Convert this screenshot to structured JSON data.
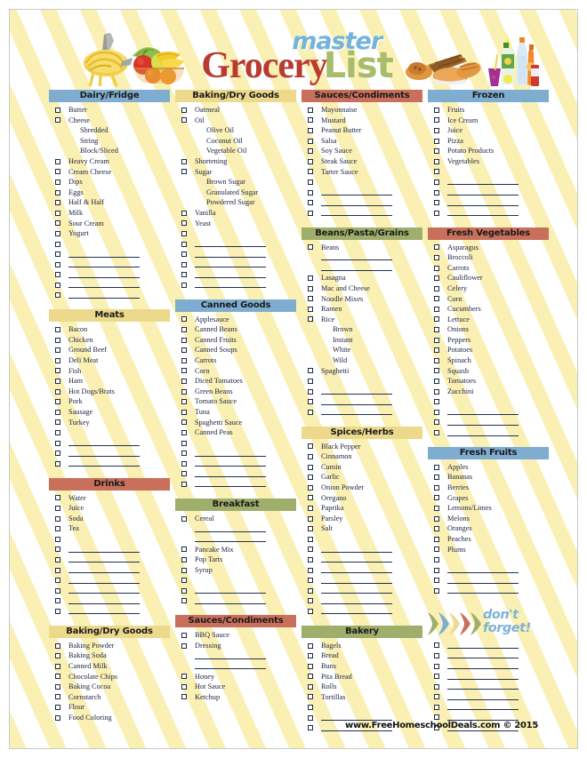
{
  "page": {
    "title": "master Grocery List",
    "logo": {
      "master": "master",
      "grocery": "Grocery",
      "list": "List"
    },
    "footer": "www.FreeHomeschoolDeals.com © 2015",
    "dont_forget": {
      "line1": "don't",
      "line2": "forget!"
    }
  },
  "colors": {
    "blue": "#7fadd0",
    "yellow": "#ecd98c",
    "red": "#c9705c",
    "green": "#9fae6b",
    "stripe": "#faf0b4",
    "logo_master": "#74b3db",
    "logo_grocery": "#b93b30",
    "logo_list": "#a7bd6b",
    "text": "#1d2340"
  },
  "columns": [
    {
      "name": "column-1",
      "sections": [
        {
          "title": "Dairy/Fridge",
          "color": "blue",
          "items": [
            {
              "type": "item",
              "label": "Butter"
            },
            {
              "type": "item",
              "label": "Cheese"
            },
            {
              "type": "sub",
              "label": "Shredded"
            },
            {
              "type": "sub",
              "label": "String"
            },
            {
              "type": "sub",
              "label": "Block/Sliced"
            },
            {
              "type": "item",
              "label": "Heavy Cream"
            },
            {
              "type": "item",
              "label": "Cream Cheese"
            },
            {
              "type": "item",
              "label": "Dips"
            },
            {
              "type": "item",
              "label": "Eggs"
            },
            {
              "type": "item",
              "label": "Half & Half"
            },
            {
              "type": "item",
              "label": "Milk"
            },
            {
              "type": "item",
              "label": "Sour Cream"
            },
            {
              "type": "item",
              "label": "Yogurt"
            },
            {
              "type": "blank"
            },
            {
              "type": "rule"
            },
            {
              "type": "rule"
            },
            {
              "type": "rule"
            },
            {
              "type": "rule"
            },
            {
              "type": "rule"
            }
          ]
        },
        {
          "title": "Meats",
          "color": "yellow",
          "items": [
            {
              "type": "item",
              "label": "Bacon"
            },
            {
              "type": "item",
              "label": "Chicken"
            },
            {
              "type": "item",
              "label": "Ground Beef"
            },
            {
              "type": "item",
              "label": "Deli Meat"
            },
            {
              "type": "item",
              "label": "Fish"
            },
            {
              "type": "item",
              "label": "Ham"
            },
            {
              "type": "item",
              "label": "Hot Dogs/Brats"
            },
            {
              "type": "item",
              "label": "Pork"
            },
            {
              "type": "item",
              "label": "Sausage"
            },
            {
              "type": "item",
              "label": "Turkey"
            },
            {
              "type": "blank"
            },
            {
              "type": "rule"
            },
            {
              "type": "rule"
            },
            {
              "type": "rule"
            }
          ]
        },
        {
          "title": "Drinks",
          "color": "red",
          "items": [
            {
              "type": "item",
              "label": "Water"
            },
            {
              "type": "item",
              "label": "Juice"
            },
            {
              "type": "item",
              "label": "Soda"
            },
            {
              "type": "item",
              "label": "Tea"
            },
            {
              "type": "blank"
            },
            {
              "type": "rule"
            },
            {
              "type": "rule"
            },
            {
              "type": "rule"
            },
            {
              "type": "rule"
            },
            {
              "type": "rule"
            },
            {
              "type": "rule"
            },
            {
              "type": "rule"
            }
          ]
        },
        {
          "title": "Baking/Dry Goods",
          "color": "yellow",
          "items": [
            {
              "type": "item",
              "label": "Baking Powder"
            },
            {
              "type": "item",
              "label": "Baking Soda"
            },
            {
              "type": "item",
              "label": "Canned Milk"
            },
            {
              "type": "item",
              "label": "Chocolate Chips"
            },
            {
              "type": "item",
              "label": "Baking Cocoa"
            },
            {
              "type": "item",
              "label": "Cornstarch"
            },
            {
              "type": "item",
              "label": "Flour"
            },
            {
              "type": "item",
              "label": "Food Coloring"
            }
          ]
        }
      ]
    },
    {
      "name": "column-2",
      "sections": [
        {
          "title": "Baking/Dry Goods",
          "color": "yellow",
          "items": [
            {
              "type": "item",
              "label": "Oatmeal"
            },
            {
              "type": "item",
              "label": "Oil"
            },
            {
              "type": "sub",
              "label": "Olive Oil"
            },
            {
              "type": "sub",
              "label": "Coconut Oil"
            },
            {
              "type": "sub",
              "label": "Vegetable Oil"
            },
            {
              "type": "item",
              "label": "Shortening"
            },
            {
              "type": "item",
              "label": "Sugar"
            },
            {
              "type": "sub",
              "label": "Brown Sugar"
            },
            {
              "type": "sub",
              "label": "Granulated Sugar"
            },
            {
              "type": "sub",
              "label": "Powdered Sugar"
            },
            {
              "type": "item",
              "label": "Vanilla"
            },
            {
              "type": "item",
              "label": "Yeast"
            },
            {
              "type": "blank"
            },
            {
              "type": "rule"
            },
            {
              "type": "rule"
            },
            {
              "type": "rule"
            },
            {
              "type": "rule"
            },
            {
              "type": "rule"
            }
          ]
        },
        {
          "title": "Canned Goods",
          "color": "blue",
          "items": [
            {
              "type": "item",
              "label": "Applesauce"
            },
            {
              "type": "item",
              "label": "Canned Beans"
            },
            {
              "type": "item",
              "label": "Canned Fruits"
            },
            {
              "type": "item",
              "label": "Canned Soups"
            },
            {
              "type": "item",
              "label": "Carrots"
            },
            {
              "type": "item",
              "label": "Corn"
            },
            {
              "type": "item",
              "label": "Diced Tomatoes"
            },
            {
              "type": "item",
              "label": "Green Beans"
            },
            {
              "type": "item",
              "label": "Tomato Sauce"
            },
            {
              "type": "item",
              "label": "Tuna"
            },
            {
              "type": "item",
              "label": "Spaghetti Sauce"
            },
            {
              "type": "item",
              "label": "Canned Peas"
            },
            {
              "type": "blank"
            },
            {
              "type": "rule"
            },
            {
              "type": "rule"
            },
            {
              "type": "rule"
            },
            {
              "type": "rule"
            }
          ]
        },
        {
          "title": "Breakfast",
          "color": "green",
          "items": [
            {
              "type": "item",
              "label": "Cereal"
            },
            {
              "type": "ruleonly"
            },
            {
              "type": "ruleonly"
            },
            {
              "type": "item",
              "label": "Pancake Mix"
            },
            {
              "type": "item",
              "label": "Pop Tarts"
            },
            {
              "type": "item",
              "label": "Syrup"
            },
            {
              "type": "blank"
            },
            {
              "type": "rule"
            },
            {
              "type": "rule"
            }
          ]
        },
        {
          "title": "Sauces/Condiments",
          "color": "red",
          "items": [
            {
              "type": "item",
              "label": "BBQ Sauce"
            },
            {
              "type": "item",
              "label": "Dressing"
            },
            {
              "type": "ruleonly"
            },
            {
              "type": "ruleonly"
            },
            {
              "type": "item",
              "label": "Honey"
            },
            {
              "type": "item",
              "label": "Hot Sauce"
            },
            {
              "type": "item",
              "label": "Ketchup"
            }
          ]
        }
      ]
    },
    {
      "name": "column-3",
      "sections": [
        {
          "title": "Sauces/Condiments",
          "color": "red",
          "items": [
            {
              "type": "item",
              "label": "Mayonnaise"
            },
            {
              "type": "item",
              "label": "Mustard"
            },
            {
              "type": "item",
              "label": "Peanut Butter"
            },
            {
              "type": "item",
              "label": "Salsa"
            },
            {
              "type": "item",
              "label": "Soy Sauce"
            },
            {
              "type": "item",
              "label": "Steak Sauce"
            },
            {
              "type": "item",
              "label": "Tarter Sauce"
            },
            {
              "type": "blank"
            },
            {
              "type": "rule"
            },
            {
              "type": "rule"
            },
            {
              "type": "rule"
            }
          ]
        },
        {
          "title": "Beans/Pasta/Grains",
          "color": "green",
          "items": [
            {
              "type": "item",
              "label": "Beans"
            },
            {
              "type": "ruleonly"
            },
            {
              "type": "ruleonly"
            },
            {
              "type": "item",
              "label": "Lasagna"
            },
            {
              "type": "item",
              "label": "Mac and Cheese"
            },
            {
              "type": "item",
              "label": "Noodle Mixes"
            },
            {
              "type": "item",
              "label": "Ramen"
            },
            {
              "type": "item",
              "label": "Rice"
            },
            {
              "type": "sub",
              "label": "Brown"
            },
            {
              "type": "sub",
              "label": "Instant"
            },
            {
              "type": "sub",
              "label": "White"
            },
            {
              "type": "sub",
              "label": "Wild"
            },
            {
              "type": "item",
              "label": "Spaghetti"
            },
            {
              "type": "blank"
            },
            {
              "type": "rule"
            },
            {
              "type": "rule"
            },
            {
              "type": "rule"
            }
          ]
        },
        {
          "title": "Spices/Herbs",
          "color": "yellow",
          "items": [
            {
              "type": "item",
              "label": "Black Pepper"
            },
            {
              "type": "item",
              "label": "Cinnamon"
            },
            {
              "type": "item",
              "label": "Cumin"
            },
            {
              "type": "item",
              "label": "Garlic"
            },
            {
              "type": "item",
              "label": "Onion Powder"
            },
            {
              "type": "item",
              "label": "Oregano"
            },
            {
              "type": "item",
              "label": "Paprika"
            },
            {
              "type": "item",
              "label": "Parsley"
            },
            {
              "type": "item",
              "label": "Salt"
            },
            {
              "type": "blank"
            },
            {
              "type": "rule"
            },
            {
              "type": "rule"
            },
            {
              "type": "rule"
            },
            {
              "type": "rule"
            },
            {
              "type": "rule"
            },
            {
              "type": "rule"
            },
            {
              "type": "rule"
            }
          ]
        },
        {
          "title": "Bakery",
          "color": "green",
          "items": [
            {
              "type": "item",
              "label": "Bagels"
            },
            {
              "type": "item",
              "label": "Bread"
            },
            {
              "type": "item",
              "label": "Buns"
            },
            {
              "type": "item",
              "label": "Pita Bread"
            },
            {
              "type": "item",
              "label": "Rolls"
            },
            {
              "type": "item",
              "label": "Tortillas"
            },
            {
              "type": "blank"
            },
            {
              "type": "rule"
            },
            {
              "type": "rule"
            }
          ]
        }
      ]
    },
    {
      "name": "column-4",
      "sections": [
        {
          "title": "Frozen",
          "color": "blue",
          "items": [
            {
              "type": "item",
              "label": "Fruits"
            },
            {
              "type": "item",
              "label": "Ice Cream"
            },
            {
              "type": "item",
              "label": "Juice"
            },
            {
              "type": "item",
              "label": "Pizza"
            },
            {
              "type": "item",
              "label": "Potato Products"
            },
            {
              "type": "item",
              "label": "Vegetables"
            },
            {
              "type": "blank"
            },
            {
              "type": "rule"
            },
            {
              "type": "rule"
            },
            {
              "type": "rule"
            },
            {
              "type": "rule"
            }
          ]
        },
        {
          "title": "Fresh Vegetables",
          "color": "red",
          "items": [
            {
              "type": "item",
              "label": "Asparagus"
            },
            {
              "type": "item",
              "label": "Broccoli"
            },
            {
              "type": "item",
              "label": "Carrots"
            },
            {
              "type": "item",
              "label": "Cauliflower"
            },
            {
              "type": "item",
              "label": "Celery"
            },
            {
              "type": "item",
              "label": "Corn"
            },
            {
              "type": "item",
              "label": "Cucumbers"
            },
            {
              "type": "item",
              "label": "Lettuce"
            },
            {
              "type": "item",
              "label": "Onions"
            },
            {
              "type": "item",
              "label": "Peppers"
            },
            {
              "type": "item",
              "label": "Potatoes"
            },
            {
              "type": "item",
              "label": "Spinach"
            },
            {
              "type": "item",
              "label": "Squash"
            },
            {
              "type": "item",
              "label": "Tomatoes"
            },
            {
              "type": "item",
              "label": "Zucchini"
            },
            {
              "type": "blank"
            },
            {
              "type": "rule"
            },
            {
              "type": "rule"
            },
            {
              "type": "rule"
            }
          ]
        },
        {
          "title": "Fresh Fruits",
          "color": "blue",
          "items": [
            {
              "type": "item",
              "label": "Apples"
            },
            {
              "type": "item",
              "label": "Bananas"
            },
            {
              "type": "item",
              "label": "Berries"
            },
            {
              "type": "item",
              "label": "Grapes"
            },
            {
              "type": "item",
              "label": "Lemons/Limes"
            },
            {
              "type": "item",
              "label": "Melons"
            },
            {
              "type": "item",
              "label": "Oranges"
            },
            {
              "type": "item",
              "label": "Peaches"
            },
            {
              "type": "item",
              "label": "Plums"
            },
            {
              "type": "blank"
            },
            {
              "type": "rule"
            },
            {
              "type": "rule"
            },
            {
              "type": "rule"
            }
          ]
        },
        {
          "title": "",
          "color": "none",
          "banner": "dont-forget",
          "items": [
            {
              "type": "rule"
            },
            {
              "type": "rule"
            },
            {
              "type": "rule"
            },
            {
              "type": "rule"
            },
            {
              "type": "rule"
            },
            {
              "type": "rule"
            },
            {
              "type": "rule"
            },
            {
              "type": "rule"
            },
            {
              "type": "rule"
            }
          ]
        }
      ]
    }
  ]
}
